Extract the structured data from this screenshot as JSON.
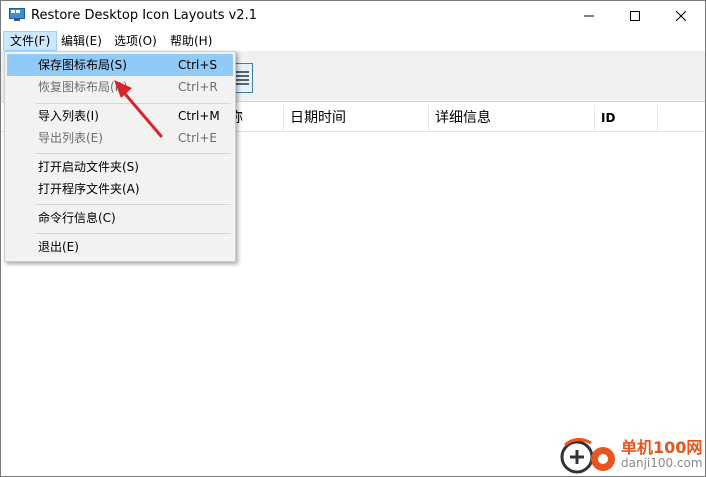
{
  "window": {
    "title": "Restore Desktop Icon Layouts v2.1"
  },
  "menubar": {
    "items": [
      "文件(F)",
      "编辑(E)",
      "选项(O)",
      "帮助(H)"
    ]
  },
  "list": {
    "columns": [
      "日期时间",
      "详细信息",
      "ID"
    ],
    "partial_column_fragment": "称"
  },
  "file_menu": {
    "items": [
      {
        "label": "保存图标布局(S)",
        "shortcut": "Ctrl+S",
        "enabled": true,
        "highlighted": true
      },
      {
        "label": "恢复图标布局(R)",
        "shortcut": "Ctrl+R",
        "enabled": false
      },
      {
        "label": "导入列表(I)",
        "shortcut": "Ctrl+M",
        "enabled": true
      },
      {
        "label": "导出列表(E)",
        "shortcut": "Ctrl+E",
        "enabled": false
      },
      {
        "label": "打开启动文件夹(S)",
        "shortcut": "",
        "enabled": true
      },
      {
        "label": "打开程序文件夹(A)",
        "shortcut": "",
        "enabled": true
      },
      {
        "label": "命令行信息(C)",
        "shortcut": "",
        "enabled": true
      },
      {
        "label": "退出(E)",
        "shortcut": "",
        "enabled": true
      }
    ]
  },
  "watermark": {
    "text": "单机100网",
    "url": "danji100.com"
  },
  "colors": {
    "highlight": "#91c9f7",
    "menu_active": "#cce8ff",
    "annotation_arrow": "#d9232b",
    "watermark": "#e6561d"
  }
}
